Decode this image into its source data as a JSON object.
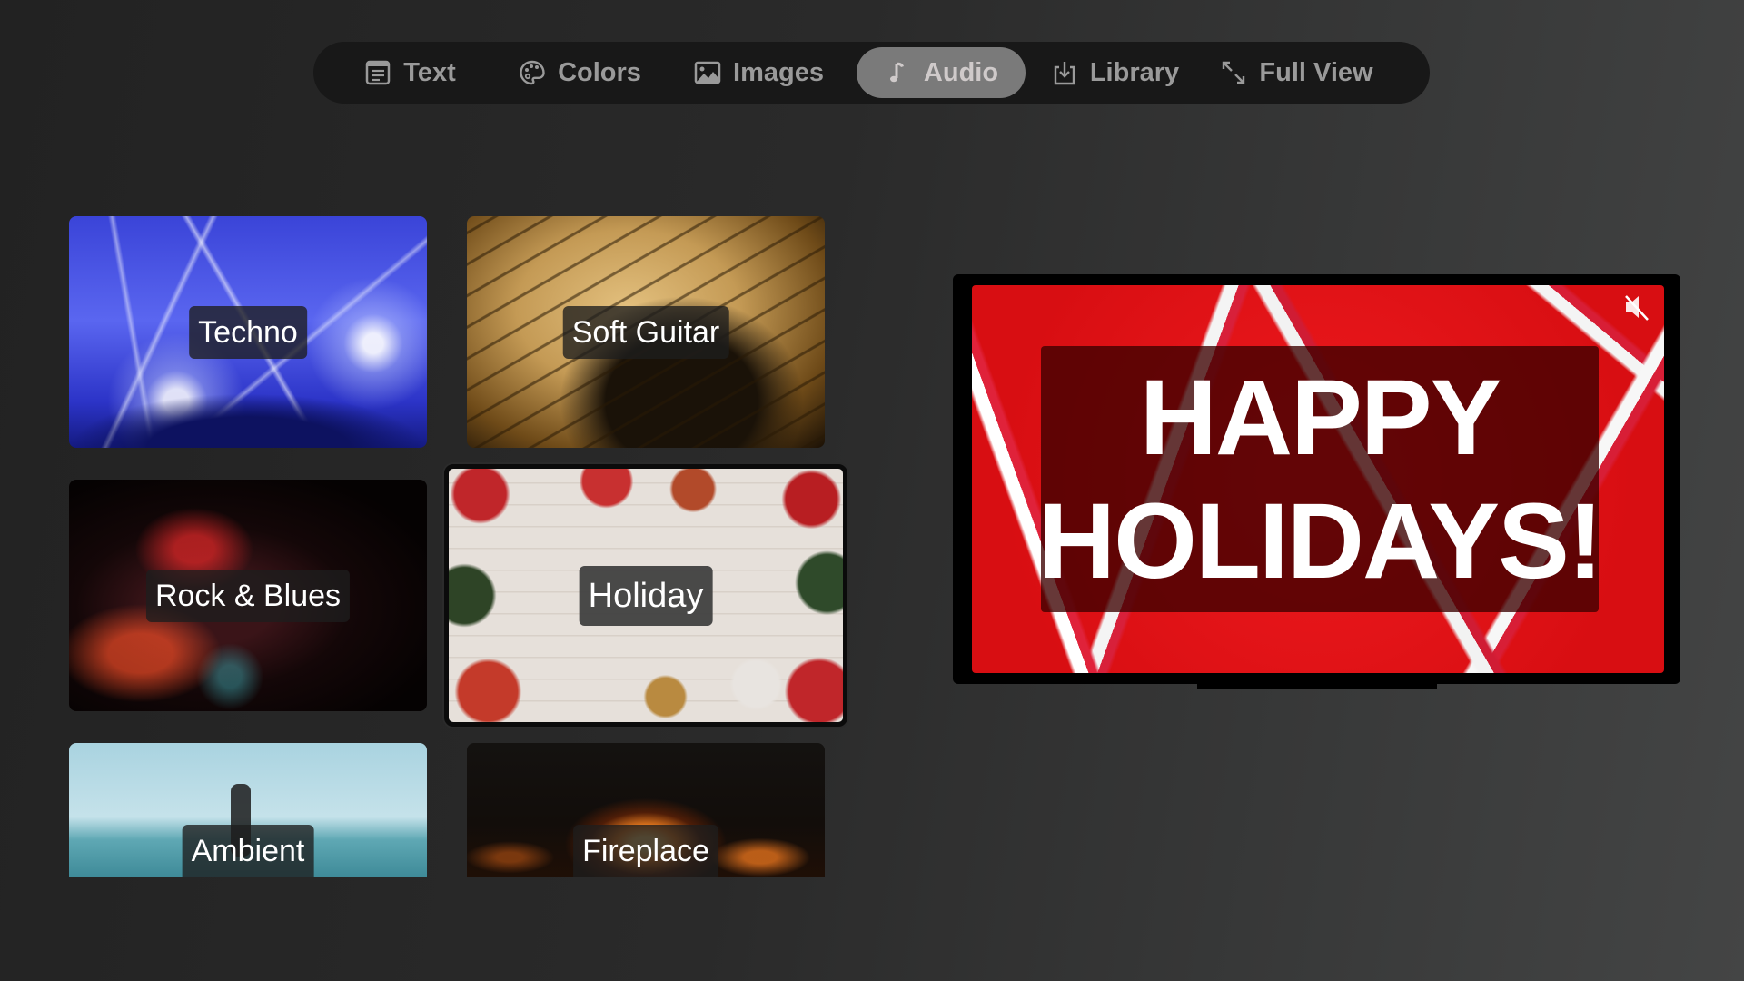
{
  "toolbar": {
    "tabs": [
      {
        "label": "Text",
        "icon": "text-document-icon",
        "active": false
      },
      {
        "label": "Colors",
        "icon": "palette-icon",
        "active": false
      },
      {
        "label": "Images",
        "icon": "image-icon",
        "active": false
      },
      {
        "label": "Audio",
        "icon": "music-note-icon",
        "active": true
      },
      {
        "label": "Library",
        "icon": "download-tray-icon",
        "active": false
      },
      {
        "label": "Full View",
        "icon": "expand-arrows-icon",
        "active": false
      }
    ]
  },
  "audio_tracks": [
    {
      "label": "Techno",
      "selected": false
    },
    {
      "label": "Soft Guitar",
      "selected": false
    },
    {
      "label": "Rock & Blues",
      "selected": false
    },
    {
      "label": "Holiday",
      "selected": true
    },
    {
      "label": "Ambient",
      "selected": false
    },
    {
      "label": "Fireplace",
      "selected": false
    }
  ],
  "preview": {
    "lines": [
      "HAPPY",
      "HOLIDAYS!"
    ],
    "muted": true,
    "mute_icon": "speaker-muted-icon"
  },
  "colors": {
    "toolbar_bg": "#181818",
    "active_tab_bg": "#7a7a7a",
    "preview_bg": "#e21216",
    "banner_bg": "#3c0000"
  }
}
